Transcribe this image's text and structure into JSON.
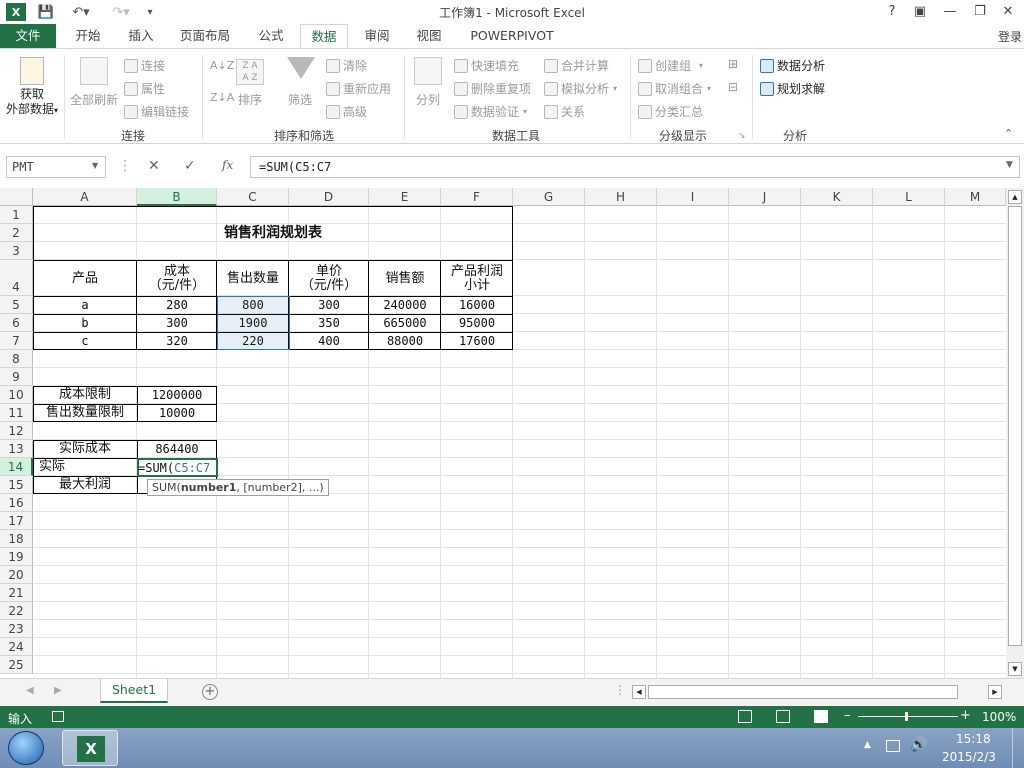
{
  "app": {
    "window_title": "工作簿1 - Microsoft Excel",
    "login": "登录",
    "help": "?"
  },
  "tabs": [
    {
      "label": "文件"
    },
    {
      "label": "开始"
    },
    {
      "label": "插入"
    },
    {
      "label": "页面布局"
    },
    {
      "label": "公式"
    },
    {
      "label": "数据"
    },
    {
      "label": "审阅"
    },
    {
      "label": "视图"
    },
    {
      "label": "POWERPIVOT"
    }
  ],
  "ribbon": {
    "get_external": [
      "获取",
      "外部数据"
    ],
    "refresh_all": "全部刷新",
    "conn": {
      "connections": "连接",
      "properties": "属性",
      "edit_links": "编辑链接",
      "group": "连接"
    },
    "sort": {
      "sort": "排序",
      "filter": "筛选",
      "clear": "清除",
      "reapply": "重新应用",
      "advanced": "高级",
      "group": "排序和筛选"
    },
    "tools": {
      "text_to_col": "分列",
      "flash_fill": "快速填充",
      "remove_dup": "删除重复项",
      "validation": "数据验证",
      "consolidate": "合并计算",
      "whatif": "模拟分析",
      "relations": "关系",
      "group": "数据工具"
    },
    "outline": {
      "group_btn": "创建组",
      "ungroup": "取消组合",
      "subtotal": "分类汇总",
      "group": "分级显示"
    },
    "analysis": {
      "data_analysis": "数据分析",
      "solver": "规划求解",
      "group": "分析"
    }
  },
  "formula_bar": {
    "name_box": "PMT",
    "fx": "fx",
    "formula": "=SUM(C5:C7"
  },
  "columns": [
    "A",
    "B",
    "C",
    "D",
    "E",
    "F",
    "G",
    "H",
    "I",
    "J",
    "K",
    "L",
    "M"
  ],
  "rows": [
    "1",
    "2",
    "3",
    "4",
    "5",
    "6",
    "7",
    "8",
    "9",
    "10",
    "11",
    "12",
    "13",
    "14",
    "15",
    "16",
    "17",
    "18",
    "19",
    "20",
    "21",
    "22",
    "23",
    "24",
    "25"
  ],
  "sheet": {
    "title": "销售利润规划表",
    "headers": [
      "产品",
      "成本\n（元/件）",
      "售出数量",
      "单价\n（元/件）",
      "销售额",
      "产品利润\n小计"
    ],
    "data": [
      [
        "a",
        "280",
        "800",
        "300",
        "240000",
        "16000"
      ],
      [
        "b",
        "300",
        "1900",
        "350",
        "665000",
        "95000"
      ],
      [
        "c",
        "320",
        "220",
        "400",
        "88000",
        "17600"
      ]
    ],
    "cost_limit_label": "成本限制",
    "cost_limit": "1200000",
    "qty_limit_label": "售出数量限制",
    "qty_limit": "10000",
    "actual_cost_label": "实际成本",
    "actual_cost": "864400",
    "editing_label": "实际",
    "editing_formula_prefix": "=SUM(",
    "editing_formula_ref": "C5:C7",
    "max_profit_label": "最大利润"
  },
  "tooltip": {
    "fn": "SUM(",
    "arg1": "number1",
    "rest": ", [number2], ...)"
  },
  "sheet_tabs": [
    "Sheet1"
  ],
  "status": {
    "mode": "输入",
    "zoom": "100%"
  },
  "taskbar": {
    "time": "15:18",
    "date": "2015/2/3"
  },
  "colors": {
    "excel_green": "#217346",
    "ref_blue": "#2e75b6"
  }
}
